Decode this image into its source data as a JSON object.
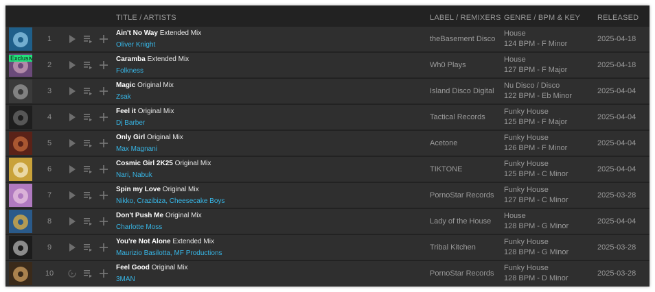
{
  "header": {
    "title": "TITLE / ARTISTS",
    "label": "LABEL / REMIXERS",
    "genre": "GENRE / BPM & KEY",
    "released": "RELEASED"
  },
  "tracks": [
    {
      "num": "1",
      "title": "Ain't No Way",
      "mix": "Extended Mix",
      "artists": "Oliver Knight",
      "label": "theBasement Disco",
      "genre": "House",
      "bpm": "124 BPM - F Minor",
      "released": "2025-04-18",
      "badge": ""
    },
    {
      "num": "2",
      "title": "Caramba",
      "mix": "Extended Mix",
      "artists": "Folkness",
      "label": "Wh0 Plays",
      "genre": "House",
      "bpm": "127 BPM - F Major",
      "released": "2025-04-18",
      "badge": "Exclusive"
    },
    {
      "num": "3",
      "title": "Magic",
      "mix": "Original Mix",
      "artists": "Zsak",
      "label": "Island Disco Digital",
      "genre": "Nu Disco / Disco",
      "bpm": "122 BPM - Eb Minor",
      "released": "2025-04-04",
      "badge": ""
    },
    {
      "num": "4",
      "title": "Feel it",
      "mix": "Original Mix",
      "artists": "Dj Barber",
      "label": "Tactical Records",
      "genre": "Funky House",
      "bpm": "125 BPM - F Major",
      "released": "2025-04-04",
      "badge": ""
    },
    {
      "num": "5",
      "title": "Only Girl",
      "mix": "Original Mix",
      "artists": "Max Magnani",
      "label": "Acetone",
      "genre": "Funky House",
      "bpm": "126 BPM - F Minor",
      "released": "2025-04-04",
      "badge": ""
    },
    {
      "num": "6",
      "title": "Cosmic Girl 2K25",
      "mix": "Original Mix",
      "artists": "Nari, Nabuk",
      "label": "TIKTONE",
      "genre": "Funky House",
      "bpm": "125 BPM - C Minor",
      "released": "2025-04-04",
      "badge": ""
    },
    {
      "num": "7",
      "title": "Spin my Love",
      "mix": "Original Mix",
      "artists": "Nikko, Crazibiza, Cheesecake Boys",
      "label": "PornoStar Records",
      "genre": "Funky House",
      "bpm": "127 BPM - C Minor",
      "released": "2025-03-28",
      "badge": ""
    },
    {
      "num": "8",
      "title": "Don't Push Me",
      "mix": "Original Mix",
      "artists": "Charlotte Moss",
      "label": "Lady of the House",
      "genre": "House",
      "bpm": "128 BPM - G Minor",
      "released": "2025-04-04",
      "badge": ""
    },
    {
      "num": "9",
      "title": "You're Not Alone",
      "mix": "Extended Mix",
      "artists": "Maurizio Basilotta, MF Productions",
      "label": "Tribal Kitchen",
      "genre": "Funky House",
      "bpm": "128 BPM - G Minor",
      "released": "2025-03-28",
      "badge": ""
    },
    {
      "num": "10",
      "title": "Feel Good",
      "mix": "Original Mix",
      "artists": "3MAN",
      "label": "PornoStar Records",
      "genre": "Funky House",
      "bpm": "128 BPM - D Minor",
      "released": "2025-03-28",
      "badge": ""
    }
  ],
  "icons": {
    "play": "play-icon",
    "queue": "add-to-queue-icon",
    "add": "plus-icon",
    "loading": "loading-icon"
  },
  "colors": {
    "background": "#222222",
    "row": "#2f2f2f",
    "artist_link": "#37b6e6",
    "exclusive_badge": "#22e07a"
  }
}
